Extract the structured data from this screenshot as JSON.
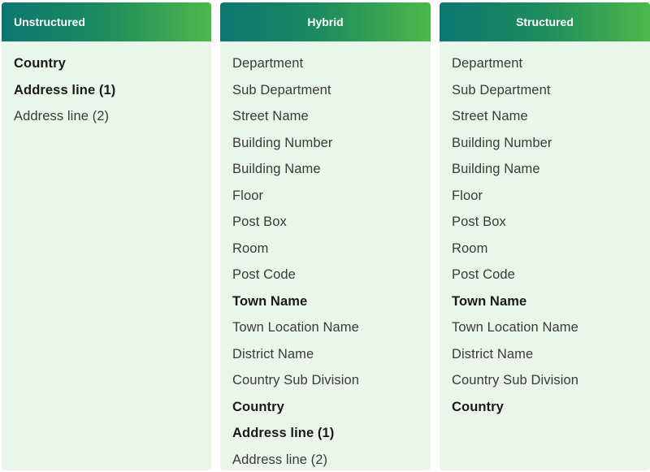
{
  "columns": [
    {
      "id": "unstructured",
      "title": "Unstructured",
      "fields": [
        {
          "label": "Country",
          "required": true
        },
        {
          "label": "Address line (1)",
          "required": true
        },
        {
          "label": "Address line (2)",
          "required": false
        }
      ]
    },
    {
      "id": "hybrid",
      "title": "Hybrid",
      "fields": [
        {
          "label": "Department",
          "required": false
        },
        {
          "label": "Sub Department",
          "required": false
        },
        {
          "label": "Street Name",
          "required": false
        },
        {
          "label": "Building Number",
          "required": false
        },
        {
          "label": "Building Name",
          "required": false
        },
        {
          "label": "Floor",
          "required": false
        },
        {
          "label": "Post Box",
          "required": false
        },
        {
          "label": "Room",
          "required": false
        },
        {
          "label": "Post Code",
          "required": false
        },
        {
          "label": "Town Name",
          "required": true
        },
        {
          "label": "Town Location Name",
          "required": false
        },
        {
          "label": "District Name",
          "required": false
        },
        {
          "label": "Country Sub Division",
          "required": false
        },
        {
          "label": "Country",
          "required": true
        },
        {
          "label": "Address line (1)",
          "required": true
        },
        {
          "label": "Address line (2)",
          "required": false
        }
      ]
    },
    {
      "id": "structured",
      "title": "Structured",
      "fields": [
        {
          "label": "Department",
          "required": false
        },
        {
          "label": "Sub Department",
          "required": false
        },
        {
          "label": "Street Name",
          "required": false
        },
        {
          "label": "Building Number",
          "required": false
        },
        {
          "label": "Building Name",
          "required": false
        },
        {
          "label": "Floor",
          "required": false
        },
        {
          "label": "Post Box",
          "required": false
        },
        {
          "label": "Room",
          "required": false
        },
        {
          "label": "Post Code",
          "required": false
        },
        {
          "label": "Town Name",
          "required": true
        },
        {
          "label": "Town Location Name",
          "required": false
        },
        {
          "label": "District Name",
          "required": false
        },
        {
          "label": "Country Sub Division",
          "required": false
        },
        {
          "label": "Country",
          "required": true
        }
      ]
    }
  ],
  "colors": {
    "header_gradient_start": "#0b7670",
    "header_gradient_end": "#4db84a",
    "column_background": "#eaf6ea",
    "text_regular": "#3a3a3a",
    "text_bold": "#1a1a1a"
  }
}
